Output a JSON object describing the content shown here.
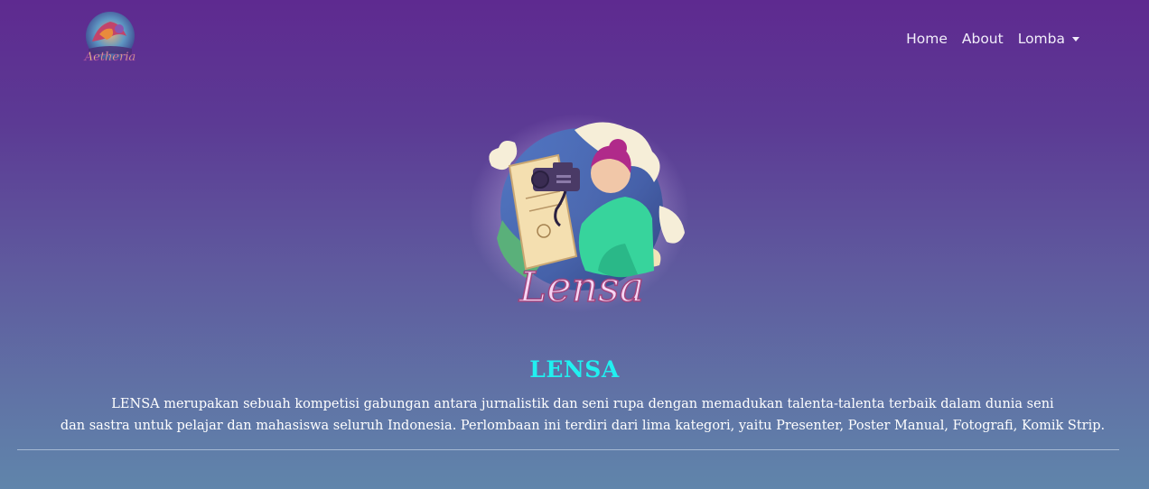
{
  "navbar": {
    "logo_text": "Aetheria",
    "links": [
      {
        "label": "Home"
      },
      {
        "label": "About"
      },
      {
        "label": "Lomba"
      }
    ]
  },
  "hero": {
    "image_text": "Lensa",
    "title": "LENSA",
    "description_lines": [
      "LENSA merupakan sebuah kompetisi gabungan antara jurnalistik dan seni rupa dengan memadukan talenta-talenta terbaik dalam dunia seni",
      "dan sastra untuk pelajar dan mahasiswa seluruh Indonesia. Perlombaan ini terdiri dari lima kategori, yaitu Presenter, Poster Manual, Fotografi, Komik Strip."
    ]
  },
  "colors": {
    "title": "#21f0f0",
    "background_top": "#5e2a90",
    "background_bottom": "#6085ab"
  }
}
